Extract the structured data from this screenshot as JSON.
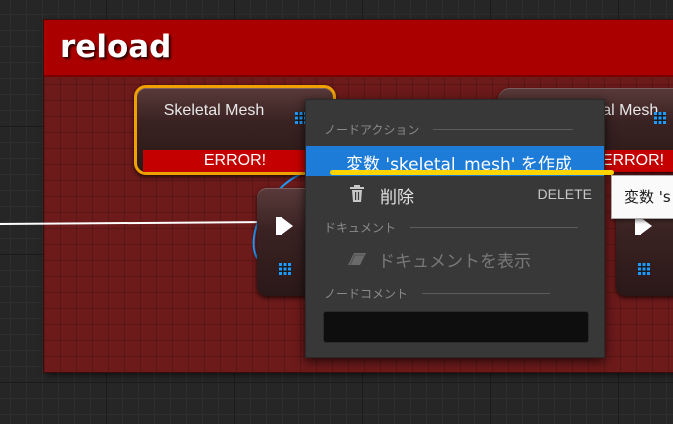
{
  "comment": {
    "title": "reload"
  },
  "nodes": {
    "left": {
      "label": "Skeletal Mesh",
      "status": "ERROR!"
    },
    "right": {
      "label": "Skeletal Mesh",
      "status": "ERROR!"
    }
  },
  "context_menu": {
    "section_node_actions": "ノードアクション",
    "create_variable": "変数 'skeletal_mesh' を作成",
    "delete_label": "削除",
    "delete_shortcut": "DELETE",
    "section_documents": "ドキュメント",
    "show_document": "ドキュメントを表示",
    "section_node_comment": "ノードコメント",
    "node_comment_value": ""
  },
  "tooltip": {
    "text": "変数 's"
  },
  "colors": {
    "comment_header": "#aa0000",
    "comment_body": "#6c1a1a",
    "error_bar": "#c40000",
    "selection_outline": "#f0a000",
    "menu_highlight": "#1e7cd9",
    "annotation_underline": "#ffd400",
    "pin_blue": "#1e9bff"
  },
  "icons": [
    "grid-icon",
    "exec-pin-icon",
    "trash-icon",
    "document-icon"
  ]
}
